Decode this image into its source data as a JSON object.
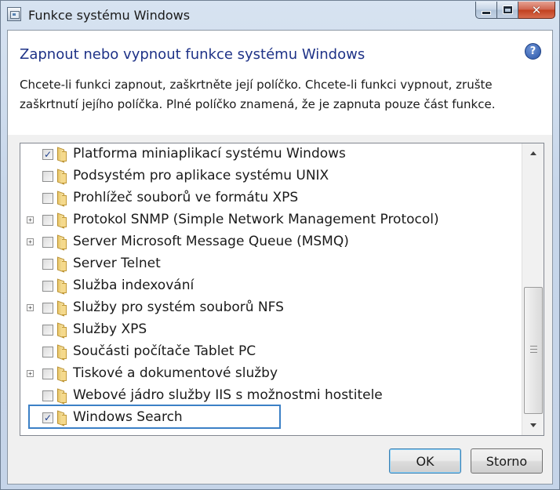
{
  "window": {
    "title": "Funkce systému Windows",
    "controls": {
      "minimize": "",
      "maximize": "",
      "close": "✕"
    }
  },
  "header": {
    "heading": "Zapnout nebo vypnout funkce systému Windows",
    "help": "?",
    "description": "Chcete-li funkci zapnout, zaškrtněte její políčko. Chcete-li funkci vypnout, zrušte zaškrtnutí jejího políčka. Plné políčko znamená, že je zapnuta pouze část funkce."
  },
  "features": [
    {
      "label": "Platforma miniaplikací systému Windows",
      "checked": true,
      "expandable": false,
      "check_mark": "✓"
    },
    {
      "label": "Podsystém pro aplikace systému UNIX",
      "checked": false,
      "expandable": false,
      "check_mark": ""
    },
    {
      "label": "Prohlížeč souborů ve formátu XPS",
      "checked": false,
      "expandable": false,
      "check_mark": ""
    },
    {
      "label": "Protokol SNMP (Simple Network Management Protocol)",
      "checked": false,
      "expandable": true,
      "check_mark": ""
    },
    {
      "label": "Server Microsoft Message Queue (MSMQ)",
      "checked": false,
      "expandable": true,
      "check_mark": ""
    },
    {
      "label": "Server Telnet",
      "checked": false,
      "expandable": false,
      "check_mark": ""
    },
    {
      "label": "Služba indexování",
      "checked": false,
      "expandable": false,
      "check_mark": ""
    },
    {
      "label": "Služby pro systém souborů NFS",
      "checked": false,
      "expandable": true,
      "check_mark": ""
    },
    {
      "label": "Služby XPS",
      "checked": false,
      "expandable": false,
      "check_mark": ""
    },
    {
      "label": "Součásti počítače Tablet PC",
      "checked": false,
      "expandable": false,
      "check_mark": ""
    },
    {
      "label": "Tiskové a dokumentové služby",
      "checked": false,
      "expandable": true,
      "check_mark": ""
    },
    {
      "label": "Webové jádro služby IIS s možnostmi hostitele",
      "checked": false,
      "expandable": false,
      "check_mark": ""
    },
    {
      "label": "Windows Search",
      "checked": true,
      "expandable": false,
      "check_mark": "✓",
      "focused": true
    }
  ],
  "expander_symbol": "+",
  "buttons": {
    "ok": "OK",
    "cancel": "Storno"
  },
  "colors": {
    "heading": "#1e3287",
    "focus": "#3b80c6",
    "check": "#1d3e8b"
  }
}
